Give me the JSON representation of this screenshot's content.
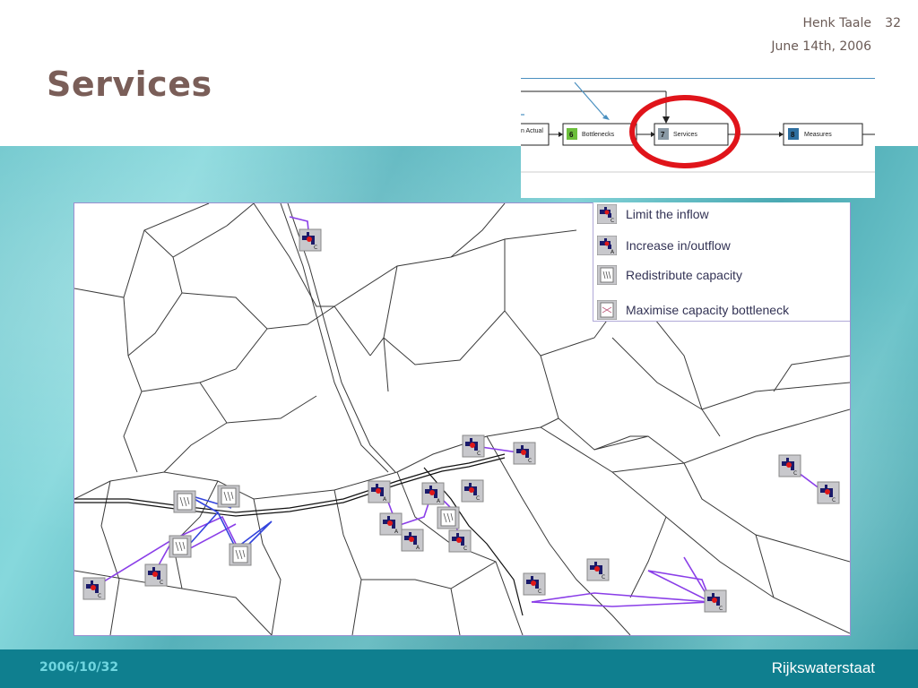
{
  "header": {
    "author": "Henk Taale",
    "slide_number": "32",
    "date": "June 14th, 2006",
    "title": "Services"
  },
  "process_diagram": {
    "steps": [
      {
        "number": "",
        "label": "n Actual"
      },
      {
        "number": "6",
        "label": "Bottlenecks",
        "color": "#6cbf3c"
      },
      {
        "number": "7",
        "label": "Services",
        "color": "#8a9aa6",
        "highlighted": true
      },
      {
        "number": "8",
        "label": "Measures",
        "color": "#2e6fa0"
      }
    ],
    "highlight_color": "#e0141a"
  },
  "legend": {
    "items": [
      {
        "label": "Limit the inflow",
        "icon": "tap-limit-inflow-icon"
      },
      {
        "label": "Increase in/outflow",
        "icon": "tap-increase-flow-icon"
      },
      {
        "label": "Redistribute capacity",
        "icon": "redistribute-capacity-icon"
      },
      {
        "label": "Maximise capacity bottleneck",
        "icon": "maximise-capacity-icon"
      }
    ]
  },
  "colors": {
    "service_line_purple": "#8a3ee8",
    "service_line_blue": "#3344dd",
    "road_line": "#333333",
    "footer_bg": "#0f7f8f"
  },
  "footer": {
    "code": "2006/10/32",
    "brand": "Rijkswaterstaat"
  }
}
